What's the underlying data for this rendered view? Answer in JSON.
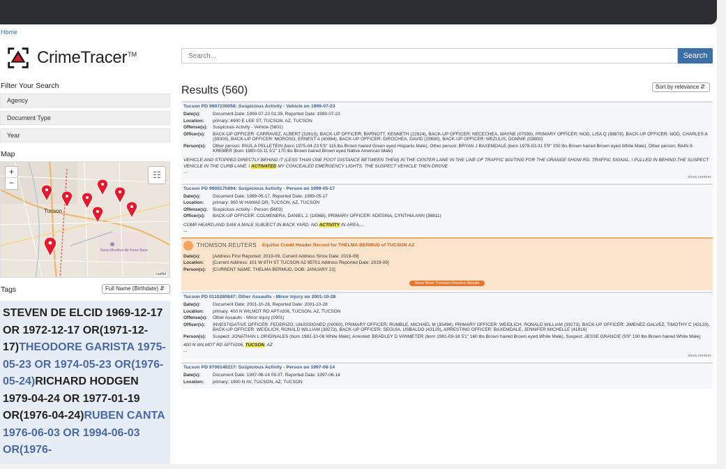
{
  "breadcrumb": "Home",
  "brand": {
    "name": "CrimeTracer",
    "tm": "TM"
  },
  "search": {
    "placeholder": "Search...",
    "button": "Search"
  },
  "filters": {
    "heading": "Filter Your Search",
    "items": [
      "Agency",
      "Document Type",
      "Year"
    ]
  },
  "map": {
    "heading": "Map",
    "city_label": "Tucson",
    "base_label": "Davis-Monthan Air Force Base",
    "zoom_in": "+",
    "zoom_out": "−",
    "attribution": "Leaflet",
    "layers_icon": "layers-icon",
    "marker_icon": "map-marker-icon",
    "marker_color": "#e8192c",
    "marker_count": 8
  },
  "tags": {
    "heading": "Tags",
    "select": "Full Name (Birthdate)",
    "entries": [
      {
        "text": "STEVEN DE ELCID 1969-12-17 OR 1972-12-17 OR(1971-12-17)",
        "alt": false
      },
      {
        "text": "THEODORE GARISTA 1975-05-23 OR 1974-05-23 OR(1976-05-24)",
        "alt": true
      },
      {
        "text": "RICHARD HODGEN 1979-04-24 OR 1977-01-19 OR(1976-04-24)",
        "alt": false
      },
      {
        "text": "RUBEN CANTA 1976-06-03 OR 1994-06-03 OR(1976-",
        "alt": true
      }
    ]
  },
  "results": {
    "title": "Results (560)",
    "sort": "Sort by relevance",
    "labels": {
      "dates": "Date(s):",
      "location": "Location:",
      "offenses": "Offense(s):",
      "officers": "Officer(s):",
      "persons": "Person(s):",
      "show_context": "show context"
    },
    "records": [
      {
        "title": "Tucson PD 9907230058: Suspicious Activity - Vehicle on 1999-07-23",
        "dates": "Document Date: 1999-07-23 01:39, Reported Date: 1999-07-23",
        "location": "primary: 4900 E LEE ST, TUCSON, AZ, TUCSON",
        "offenses": "Suspicious Activity - Vehicle (5601)",
        "officers": "BACK-UP OFFICER: CARRAVEZ, ALBERT (32619), BACK-UP OFFICER: BARNOTT, KENNETH (22924), BACK-UP OFFICER: NECECHEA, WAYNE (07938), PRIMARY OFFICER: NOD, LISA Q (38878), BACK-UP OFFICER: NOD, CHARLES A (39300), BACK-UP OFFICER: MOROSO, ERNEST A (40364), BACK-UP OFFICER: DIROCHEA, DAVID (25690), BACK-UP OFFICER: MEZULIS, DONNIE (03800)",
        "persons": "Other person: PAUL A PELLETEIN (born 1975-04-23 5'5\" 115 lbs Brown haired Green eyed Hispanic Male), Other person: BRYAN J BAXEMDALE (born 1978-03-31 5'9\" 150 lbs Brown haired Brown eyed White Male), Other person: RAIN S KREMER (born 1980-03-11 5'2\" 170 lbs Brown haired Brown eyed Native American Male)",
        "snippet_pre": "VEHICLE AND STOPPED DIRECTLY BEHIND IT (LESS THAN ONE FOOT DISTANCE BETWEEN THEM) IN THE CENTER LANE IN THE LINE OF TRAFFIC WAITING FOR THE ORANGE SHOW RD. TRAFFIC SIGNAL. I PULLED IN BEHIND THE SUSPECT VEHICLE IN THE CURB LANE. I ",
        "snippet_hl": "ACTIVATED",
        "snippet_post": " MY CONCEALED EMERGENCY LIGHTS. THE SUSPECT VEHICLE THEN DROVE",
        "ellipsis": "..."
      },
      {
        "title": "Tucson PD 9905170894: Suspicious Activity - Person on 1999-05-17",
        "dates": "Document Date: 1999-05-17, Reported Date: 1999-05-17",
        "location": "primary: 900 W HAWAII DR, TUCSON, AZ, TUCSON",
        "offenses": "Suspicious Activity - Person (5602)",
        "officers": "BACK-UP OFFICER: COLMENERA, DANIEL J. (18368), PRIMARY OFFICER: ADESINA, CYNTHIA ANN (36811)",
        "snippet_pre": "COMP HEARD AND SAW A MALE SUBJECT IN BACK YARD. NO ",
        "snippet_hl": "ACTIVITY",
        "snippet_post": " IN AREA....",
        "ellipsis": "..."
      }
    ],
    "thomson": {
      "brand": "THOMSON REUTERS",
      "title": "Equifax Credit Header Record for THELMA BERMUD of TUCSON AZ",
      "dates": "[Address First Reported: 2019-09, Current Address Since Date: 2019-09]",
      "location": "[Current Address: 101 W 6TH ST TUCSON AZ 85701 Address Reported Date: 2019-09]",
      "persons": "[CURRENT NAME: THELMA BERMUD, DOB: JANUARY 21]",
      "more": "Show More Thomson Reuters Results"
    },
    "record3": {
      "title": "Tucson PD 0110280847: Other Assaults - Minor Injury on 2001-10-28",
      "dates": "Document Date: 2001-10-28, Reported Date: 2001-10-28",
      "location": "primary: 400 N WILMOT RD APT#206, TUCSON, AZ, TUCSON",
      "offenses": "Other Assaults - Minor Injury (0901)",
      "officers": "INVESTIGATIVE OFFICER: FEDERIZO, UNASSIGNED (00000), PRIMARY OFFICER: RUMBLE, MICHAEL M (35494), PRIMARY OFFICER: WEIDLICH, RONALD WILLIAM (39273), BACK-UP OFFICER: JIMENEZ-GALVEZ, TIMOTHY C (43123), BACK-UP OFFICER: WEIDLICH, RONALD WILLIAM (39273), BACK-UP OFFICER: SEGUIA, USBALDO (43129), ARRESTING OFFICER: BAXEMDALE, JENNIFER MICHELLE (41816)",
      "persons": "Suspect: JONATHAN L ORIGINALES (born 1982-10-06 White Male), Arrested: BRADLEY D VANMETER (born 1981-09-18 5'1\" 160 lbs Brown haired Brown eyed White Male), Suspect: JESSE GRANCIE (5'9\" 190 lbs Brown haired White Male)",
      "snippet_pre": "400 N WILMOT RD APT#206, ",
      "snippet_hl": "TUCSON",
      "snippet_post": ", AZ",
      "ellipsis": "..."
    },
    "record4": {
      "title": "Tucson PD 9706140217: Suspicious Activity - Person on 1997-06-14",
      "dates": "Document Date: 1997-06-14 05:37, Reported Date: 1997-06-14",
      "location": "primary: 1900 N AV, TUCSON, AZ, TUCSON"
    }
  }
}
